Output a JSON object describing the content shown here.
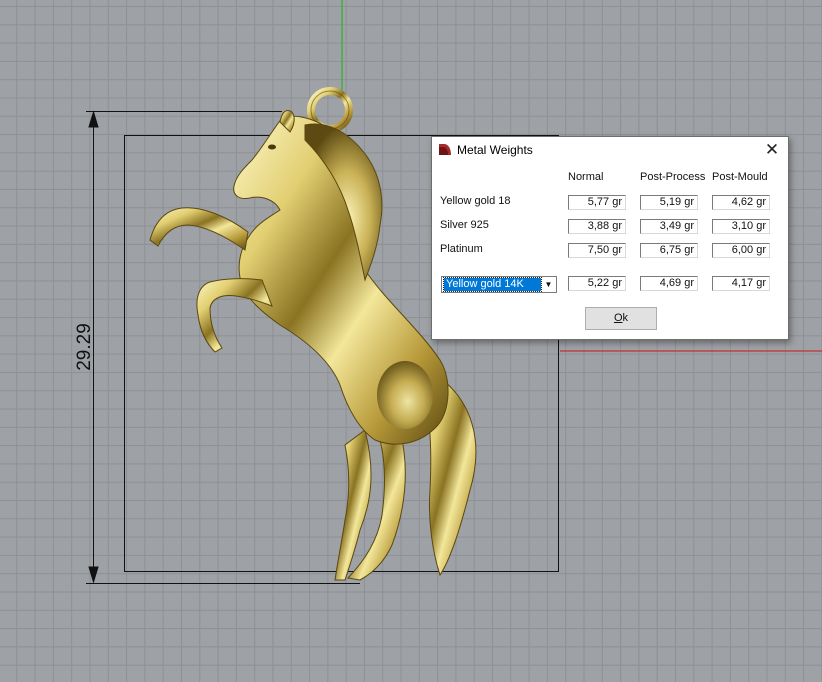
{
  "dimension": {
    "value": "29.29"
  },
  "dialog": {
    "title": "Metal Weights",
    "close_glyph": "✕",
    "columns": [
      "Normal",
      "Post-Process",
      "Post-Mould"
    ],
    "rows": [
      {
        "label": "Yellow gold 18",
        "values": [
          "5,77 gr",
          "5,19 gr",
          "4,62 gr"
        ]
      },
      {
        "label": "Silver 925",
        "values": [
          "3,88 gr",
          "3,49 gr",
          "3,10 gr"
        ]
      },
      {
        "label": "Platinum",
        "values": [
          "7,50 gr",
          "6,75 gr",
          "6,00 gr"
        ]
      }
    ],
    "custom_row": {
      "selected_metal": "Yellow gold 14K",
      "values": [
        "5,22 gr",
        "4,69 gr",
        "4,17 gr"
      ]
    },
    "ok_button": {
      "mnemonic": "O",
      "rest": "k"
    }
  },
  "colors": {
    "viewport_bg": "#9ea1a5",
    "grid_line": "#8d9094",
    "axis_y": "#2db52d",
    "axis_x": "#c43232",
    "gold_light": "#fbf4b6",
    "gold_mid": "#d9c46a",
    "gold_dark": "#6e5a17",
    "selection_blue": "#0078d7",
    "icon_red": "#a52a2a"
  },
  "icons": {
    "dialog_icon": "ring-icon",
    "close": "close-icon",
    "dropdown": "chevron-down-icon"
  }
}
